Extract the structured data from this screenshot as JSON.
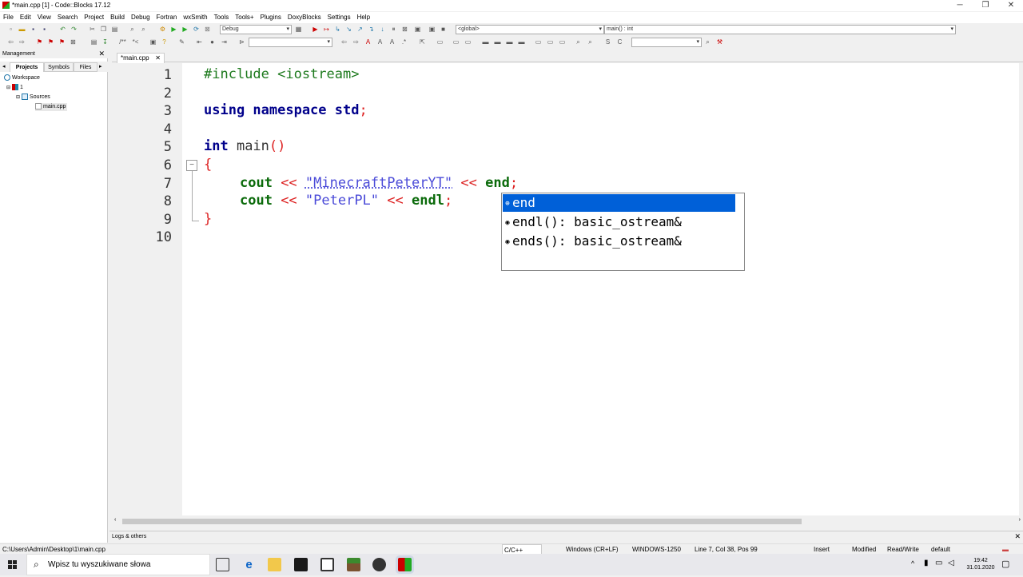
{
  "window": {
    "title": "*main.cpp [1] - Code::Blocks 17.12"
  },
  "menu": [
    "File",
    "Edit",
    "View",
    "Search",
    "Project",
    "Build",
    "Debug",
    "Fortran",
    "wxSmith",
    "Tools",
    "Tools+",
    "Plugins",
    "DoxyBlocks",
    "Settings",
    "Help"
  ],
  "toolbar": {
    "build_target": "Debug",
    "scope": "<global>",
    "function": "main() : int"
  },
  "management": {
    "title": "Management",
    "tabs": [
      "Projects",
      "Symbols",
      "Files"
    ],
    "tree": {
      "workspace": "Workspace",
      "project": "1",
      "folder": "Sources",
      "file": "main.cpp"
    }
  },
  "editor": {
    "tab_label": "*main.cpp",
    "line_numbers": [
      "1",
      "2",
      "3",
      "4",
      "5",
      "6",
      "7",
      "8",
      "9",
      "10"
    ],
    "lines": [
      {
        "pp": "#include <iostream>"
      },
      {},
      {
        "a": "using namespace",
        "b": " std",
        "c": ";"
      },
      {},
      {
        "a": "int",
        "b": " main",
        "c": "()"
      },
      {
        "brace": "{"
      },
      {
        "a": "cout",
        "op1": " << ",
        "s": "\"MinecraftPeterYT\"",
        "op2": " << ",
        "id": "end",
        "semi": ";"
      },
      {
        "a": "cout",
        "op1": " << ",
        "s": "\"PeterPL\"",
        "op2": " << ",
        "id": "endl",
        "semi": ";"
      },
      {
        "brace": "}"
      },
      {}
    ]
  },
  "autocomplete": {
    "items": [
      {
        "icon": "⊕",
        "text": "end"
      },
      {
        "icon": "◉",
        "text": "endl(): basic_ostream&"
      },
      {
        "icon": "◉",
        "text": "ends(): basic_ostream&"
      }
    ]
  },
  "logs": {
    "title": "Logs & others"
  },
  "status": {
    "path": "C:\\Users\\Admin\\Desktop\\1\\main.cpp",
    "language": "C/C++",
    "line_endings": "Windows (CR+LF)",
    "encoding": "WINDOWS-1250",
    "position": "Line 7, Col 38, Pos 99",
    "mode": "Insert",
    "modified": "Modified",
    "access": "Read/Write",
    "profile": "default"
  },
  "taskbar": {
    "search_placeholder": "Wpisz tu wyszukiwane słowa",
    "time": "19:42",
    "date": "31.01.2020"
  }
}
